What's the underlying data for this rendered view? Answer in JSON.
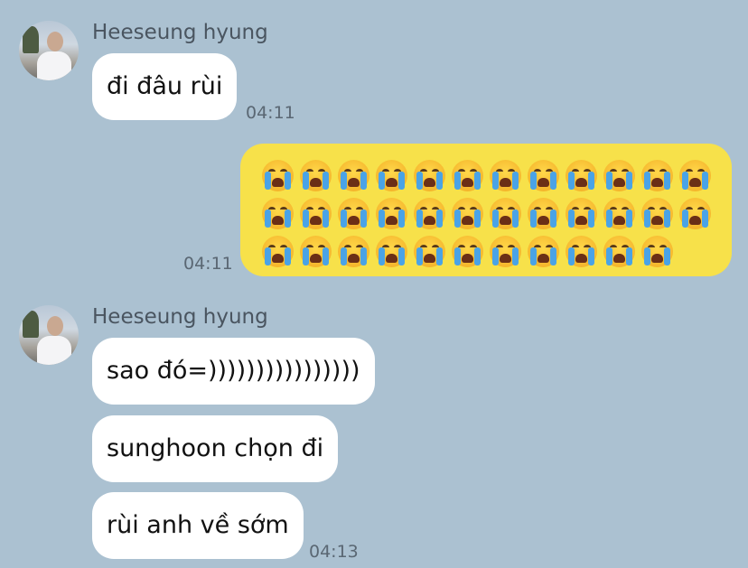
{
  "messages": [
    {
      "sender": "Heeseung hyung",
      "text": "đi đâu rùi",
      "time": "04:11"
    },
    {
      "outgoing_time": "04:11",
      "emoji": "😭",
      "emoji_rows": [
        12,
        12,
        11
      ]
    },
    {
      "sender": "Heeseung hyung",
      "texts": [
        "sao đó=))))))))))))))))",
        "sunghoon chọn đi",
        "rùi anh về sớm"
      ],
      "time": "04:13"
    }
  ],
  "colors": {
    "background": "#abc1d1",
    "incoming_bubble": "#ffffff",
    "outgoing_bubble": "#f7e14a"
  }
}
